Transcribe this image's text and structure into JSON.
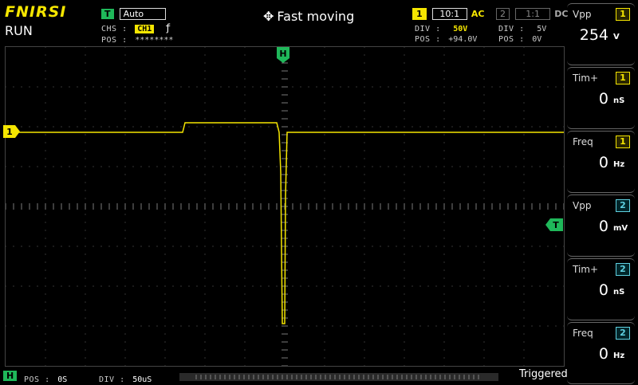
{
  "brand": "FNIRSI",
  "run_state": "RUN",
  "trigger": {
    "badge": "T",
    "mode": "Auto",
    "chs_label": "CHS :",
    "chs_value": "CH1",
    "edge_symbol": "ƒ",
    "pos_label": "POS :",
    "pos_value": "********"
  },
  "status_text": "Fast moving",
  "ch1": {
    "badge": "1",
    "probe": "10:1",
    "coupling": "AC",
    "div_label": "DIV :",
    "div_value": "50V",
    "pos_label": "POS :",
    "pos_value": "+94.0V",
    "color": "#f5e600"
  },
  "ch2": {
    "badge": "2",
    "probe": "1:1",
    "coupling": "DC",
    "div_label": "DIV :",
    "div_value": "5V",
    "pos_label": "POS :",
    "pos_value": "0V",
    "color": "#5fd0e0"
  },
  "markers": {
    "horizontal": "H",
    "trigger": "T",
    "ch1": "1"
  },
  "measurements": [
    {
      "name": "Vpp",
      "channel": "1",
      "value": "254",
      "unit": "V"
    },
    {
      "name": "Tim+",
      "channel": "1",
      "value": "0",
      "unit": "nS"
    },
    {
      "name": "Freq",
      "channel": "1",
      "value": "0",
      "unit": "Hz"
    },
    {
      "name": "Vpp",
      "channel": "2",
      "value": "0",
      "unit": "mV"
    },
    {
      "name": "Tim+",
      "channel": "2",
      "value": "0",
      "unit": "nS"
    },
    {
      "name": "Freq",
      "channel": "2",
      "value": "0",
      "unit": "Hz"
    }
  ],
  "bottom": {
    "badge": "H",
    "pos_label": "POS :",
    "pos_value": "0S",
    "div_label": "DIV :",
    "div_value": "50uS",
    "trigger_status": "Triggered"
  },
  "waveform_ch1": [
    [
      0,
      0
    ],
    [
      222,
      0
    ],
    [
      225,
      -12
    ],
    [
      340,
      -12
    ],
    [
      343,
      0
    ],
    [
      345,
      50
    ],
    [
      347,
      240
    ],
    [
      350,
      240
    ],
    [
      351,
      80
    ],
    [
      353,
      0
    ],
    [
      700,
      0
    ]
  ]
}
